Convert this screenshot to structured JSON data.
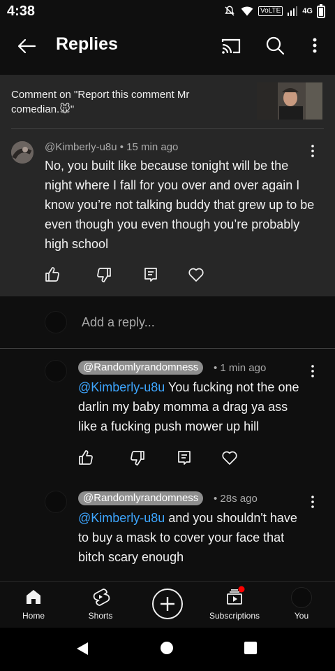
{
  "status_bar": {
    "time": "4:38",
    "volte": "VoLTE",
    "network": "4G"
  },
  "header": {
    "title": "Replies",
    "icons": [
      "back-arrow-icon",
      "cast-icon",
      "search-icon",
      "more-vert-icon"
    ]
  },
  "context": {
    "text": "Comment on \"Report this comment Mr comedian.🐭\""
  },
  "main_comment": {
    "author": "@Kimberly-u8u",
    "time": "• 15 min ago",
    "body": "No, you built like because tonight will be the night where I fall for you over and over again I know you’re not talking buddy that grew up to be even though you even though you’re probably high school"
  },
  "reply_input": {
    "placeholder": "Add a reply..."
  },
  "replies": [
    {
      "author": "@Randomlyrandomness",
      "time": "• 1 min ago",
      "mention": "@Kimberly-u8u",
      "body": " You fucking not the one darlin my baby momma a drag ya ass like a fucking push mower up hill"
    },
    {
      "author": "@Randomlyrandomness",
      "time": "• 28s ago",
      "mention": "@Kimberly-u8u",
      "body": " and you shouldn't have to buy a mask to cover your face that bitch scary enough"
    }
  ],
  "bottom_nav": {
    "home": "Home",
    "shorts": "Shorts",
    "subscriptions": "Subscriptions",
    "you": "You"
  },
  "colors": {
    "background": "#0f0f0f",
    "panel": "#272727",
    "mention": "#3ea6ff",
    "notification_dot": "#ff0000"
  }
}
